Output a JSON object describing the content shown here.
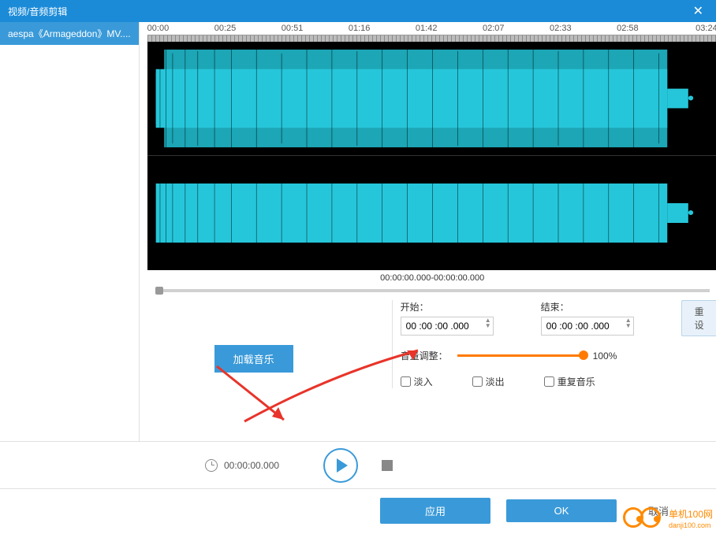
{
  "titlebar": {
    "title": "视频/音频剪辑"
  },
  "sidebar": {
    "file": "aespa《Armageddon》MV...."
  },
  "timeline": [
    "00:00",
    "00:25",
    "00:51",
    "01:16",
    "01:42",
    "02:07",
    "02:33",
    "02:58",
    "03:24"
  ],
  "time_range": "00:00:00.000-00:00:00.000",
  "fields": {
    "start_label": "开始：",
    "end_label": "结束：",
    "start_value": "00 :00 :00 .000",
    "end_value": "00 :00 :00 .000",
    "reset": "重设"
  },
  "volume": {
    "label": "音量调整：",
    "value": "100%"
  },
  "checkboxes": {
    "fadein": "淡入",
    "fadeout": "淡出",
    "repeat": "重复音乐"
  },
  "load_music": "加载音乐",
  "player": {
    "time": "00:00:00.000"
  },
  "footer": {
    "apply": "应用",
    "ok": "OK",
    "cancel": "取消"
  },
  "watermark": {
    "main": "单机100网",
    "sub": "danji100.com"
  }
}
